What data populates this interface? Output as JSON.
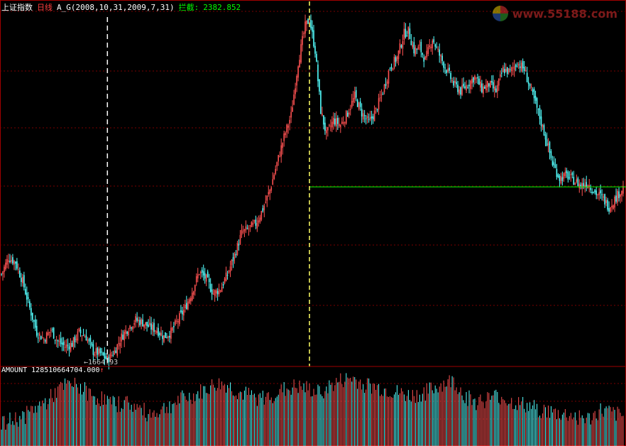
{
  "header": {
    "index_name": "上证指数",
    "period": "日线",
    "formula": "A_G(2008,10,31,2009,7,31)",
    "intercept_label": "拦截:",
    "intercept_value": "2382.852"
  },
  "low_marker": {
    "value": "1664.93"
  },
  "volume": {
    "label": "AMOUNT",
    "value": "128510664704.000",
    "trend_arrow": "↑"
  },
  "watermark": {
    "text": "www.55188.com",
    "icon": "colorful-circle-logo-icon"
  },
  "colors": {
    "background": "#000000",
    "grid": "#7a0000",
    "border": "#a00000",
    "up_candle": "#ff5252",
    "down_candle": "#54ffff",
    "support_line": "#00ff00",
    "cursor_line": "#ffff66",
    "low_marker_line": "#ffffff",
    "header_white": "#ffffff",
    "header_red": "#ff4040",
    "header_green": "#00ff00",
    "watermark": "#e03030"
  },
  "chart_data": {
    "type": "candlestick",
    "instrument": "上证指数",
    "period": "日线",
    "series": [
      {
        "name": "price",
        "close_points": [
          [
            0,
            2020
          ],
          [
            5,
            2090
          ],
          [
            10,
            2070
          ],
          [
            15,
            1990
          ],
          [
            20,
            1880
          ],
          [
            25,
            1780
          ],
          [
            30,
            1750
          ],
          [
            35,
            1790
          ],
          [
            40,
            1740
          ],
          [
            45,
            1720
          ],
          [
            50,
            1730
          ],
          [
            55,
            1780
          ],
          [
            60,
            1760
          ],
          [
            65,
            1700
          ],
          [
            70,
            1690
          ],
          [
            75,
            1665
          ],
          [
            80,
            1700
          ],
          [
            85,
            1760
          ],
          [
            90,
            1800
          ],
          [
            95,
            1830
          ],
          [
            100,
            1820
          ],
          [
            105,
            1800
          ],
          [
            110,
            1790
          ],
          [
            115,
            1760
          ],
          [
            120,
            1780
          ],
          [
            125,
            1830
          ],
          [
            130,
            1880
          ],
          [
            135,
            1950
          ],
          [
            140,
            2030
          ],
          [
            145,
            2000
          ],
          [
            150,
            1940
          ],
          [
            155,
            1960
          ],
          [
            160,
            2020
          ],
          [
            165,
            2100
          ],
          [
            170,
            2190
          ],
          [
            175,
            2210
          ],
          [
            180,
            2230
          ],
          [
            185,
            2290
          ],
          [
            190,
            2370
          ],
          [
            195,
            2480
          ],
          [
            200,
            2590
          ],
          [
            205,
            2680
          ],
          [
            210,
            2900
          ],
          [
            215,
            3050
          ],
          [
            218,
            3080
          ],
          [
            222,
            2950
          ],
          [
            226,
            2700
          ],
          [
            230,
            2600
          ],
          [
            235,
            2660
          ],
          [
            240,
            2640
          ],
          [
            245,
            2690
          ],
          [
            250,
            2760
          ],
          [
            255,
            2690
          ],
          [
            260,
            2650
          ],
          [
            265,
            2700
          ],
          [
            270,
            2780
          ],
          [
            275,
            2880
          ],
          [
            280,
            2920
          ],
          [
            285,
            3020
          ],
          [
            288,
            3030
          ],
          [
            292,
            2950
          ],
          [
            296,
            2960
          ],
          [
            300,
            2910
          ],
          [
            305,
            3000
          ],
          [
            310,
            2930
          ],
          [
            315,
            2870
          ],
          [
            320,
            2810
          ],
          [
            325,
            2780
          ],
          [
            330,
            2810
          ],
          [
            335,
            2840
          ],
          [
            340,
            2790
          ],
          [
            345,
            2810
          ],
          [
            350,
            2780
          ],
          [
            355,
            2870
          ],
          [
            360,
            2860
          ],
          [
            365,
            2900
          ],
          [
            370,
            2870
          ],
          [
            375,
            2780
          ],
          [
            380,
            2690
          ],
          [
            385,
            2590
          ],
          [
            390,
            2480
          ],
          [
            395,
            2420
          ],
          [
            400,
            2430
          ],
          [
            405,
            2410
          ],
          [
            410,
            2390
          ],
          [
            415,
            2400
          ],
          [
            420,
            2360
          ],
          [
            425,
            2340
          ],
          [
            430,
            2300
          ],
          [
            435,
            2340
          ],
          [
            440,
            2380
          ]
        ]
      },
      {
        "name": "AMOUNT",
        "relative_levels": [
          0.2,
          0.3,
          0.35,
          0.5,
          0.6,
          0.8,
          0.9,
          0.85,
          0.7,
          0.65,
          0.55,
          0.6,
          0.5,
          0.4,
          0.45,
          0.55,
          0.65,
          0.7,
          0.8,
          0.9,
          0.88,
          0.75,
          0.7,
          0.65,
          0.72,
          0.8,
          0.85,
          0.82,
          0.75,
          0.85,
          0.95,
          1.0,
          0.9,
          0.85,
          0.8,
          0.75,
          0.7,
          0.72,
          0.8,
          0.9,
          0.95,
          0.7,
          0.6,
          0.65,
          0.7,
          0.6,
          0.55,
          0.5,
          0.45,
          0.4,
          0.38,
          0.35,
          0.3,
          0.45,
          0.4,
          0.35
        ]
      }
    ],
    "support_level": 2382.852,
    "lowest_low": 1664.93,
    "grid": true
  }
}
